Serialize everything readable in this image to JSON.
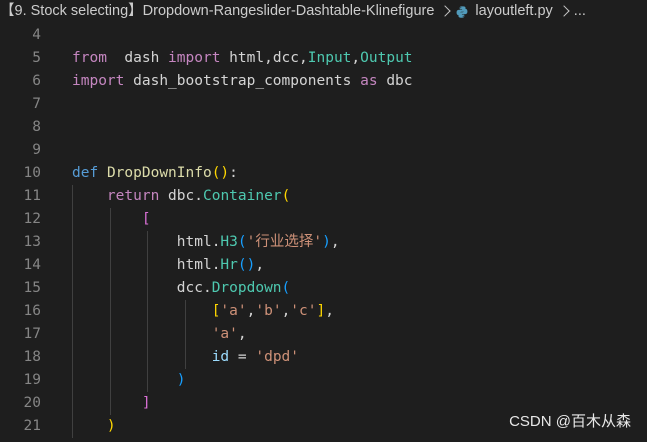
{
  "breadcrumb": {
    "folder": "【9. Stock selecting】Dropdown-Rangeslider-Dashtable-Klinefigure",
    "file": "layoutleft.py",
    "tail": "..."
  },
  "watermark": "CSDN @百木从森",
  "lines": [
    {
      "n": "4"
    },
    {
      "n": "5",
      "parts": [
        [
          "kwc",
          "from"
        ],
        [
          "",
          "  "
        ],
        [
          "",
          "dash"
        ],
        [
          "",
          " "
        ],
        [
          "kwc",
          "import"
        ],
        [
          "",
          " "
        ],
        [
          "",
          "html"
        ],
        [
          "",
          ","
        ],
        [
          "",
          "dcc"
        ],
        [
          "",
          ","
        ],
        [
          "cls",
          "Input"
        ],
        [
          "",
          ","
        ],
        [
          "cls",
          "Output"
        ]
      ]
    },
    {
      "n": "6",
      "parts": [
        [
          "kwc",
          "import"
        ],
        [
          "",
          " "
        ],
        [
          "",
          "dash_bootstrap_components"
        ],
        [
          "",
          " "
        ],
        [
          "kwc",
          "as"
        ],
        [
          "",
          " "
        ],
        [
          "",
          "dbc"
        ]
      ]
    },
    {
      "n": "7"
    },
    {
      "n": "8"
    },
    {
      "n": "9"
    },
    {
      "n": "10",
      "parts": [
        [
          "kw",
          "def"
        ],
        [
          "",
          " "
        ],
        [
          "fn",
          "DropDownInfo"
        ],
        [
          "p1",
          "()"
        ],
        [
          "",
          ":"
        ]
      ]
    },
    {
      "n": "11",
      "parts": [
        [
          "",
          "    "
        ],
        [
          "kwc",
          "return"
        ],
        [
          "",
          " "
        ],
        [
          "",
          "dbc"
        ],
        [
          "",
          "."
        ],
        [
          "cls",
          "Container"
        ],
        [
          "p1",
          "("
        ]
      ]
    },
    {
      "n": "12",
      "parts": [
        [
          "",
          "        "
        ],
        [
          "p2",
          "["
        ]
      ]
    },
    {
      "n": "13",
      "parts": [
        [
          "",
          "            "
        ],
        [
          "",
          "html"
        ],
        [
          "",
          "."
        ],
        [
          "cls",
          "H3"
        ],
        [
          "p3",
          "("
        ],
        [
          "str",
          "'行业选择'"
        ],
        [
          "p3",
          ")"
        ],
        [
          "",
          ","
        ]
      ]
    },
    {
      "n": "14",
      "parts": [
        [
          "",
          "            "
        ],
        [
          "",
          "html"
        ],
        [
          "",
          "."
        ],
        [
          "cls",
          "Hr"
        ],
        [
          "p3",
          "()"
        ],
        [
          "",
          ","
        ]
      ]
    },
    {
      "n": "15",
      "parts": [
        [
          "",
          "            "
        ],
        [
          "",
          "dcc"
        ],
        [
          "",
          "."
        ],
        [
          "cls",
          "Dropdown"
        ],
        [
          "p3",
          "("
        ]
      ]
    },
    {
      "n": "16",
      "parts": [
        [
          "",
          "                "
        ],
        [
          "p1",
          "["
        ],
        [
          "str",
          "'a'"
        ],
        [
          "",
          ","
        ],
        [
          "str",
          "'b'"
        ],
        [
          "",
          ","
        ],
        [
          "str",
          "'c'"
        ],
        [
          "p1",
          "]"
        ],
        [
          "",
          ","
        ]
      ]
    },
    {
      "n": "17",
      "parts": [
        [
          "",
          "                "
        ],
        [
          "str",
          "'a'"
        ],
        [
          "",
          ","
        ]
      ]
    },
    {
      "n": "18",
      "parts": [
        [
          "",
          "                "
        ],
        [
          "var",
          "id"
        ],
        [
          "",
          " = "
        ],
        [
          "str",
          "'dpd'"
        ]
      ]
    },
    {
      "n": "19",
      "parts": [
        [
          "",
          "            "
        ],
        [
          "p3",
          ")"
        ]
      ]
    },
    {
      "n": "20",
      "parts": [
        [
          "",
          "        "
        ],
        [
          "p2",
          "]"
        ]
      ]
    },
    {
      "n": "21",
      "parts": [
        [
          "",
          "    "
        ],
        [
          "p1",
          ")"
        ]
      ]
    }
  ]
}
